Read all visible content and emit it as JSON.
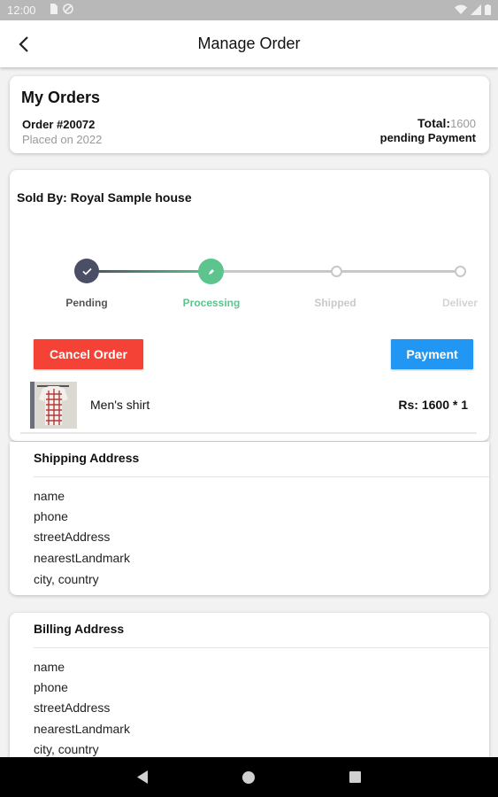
{
  "status_bar": {
    "time": "12:00"
  },
  "app_bar": {
    "title": "Manage Order"
  },
  "order_summary": {
    "heading": "My Orders",
    "order_number": "Order #20072",
    "placed": "Placed on 2022",
    "total_label": "Total:",
    "total_value": "1600",
    "payment_status": "pending Payment"
  },
  "order_detail": {
    "sold_by": "Sold By: Royal Sample house",
    "progress": {
      "current_step_index": 1,
      "steps": [
        {
          "label": "Pending",
          "state": "completed"
        },
        {
          "label": "Processing",
          "state": "current"
        },
        {
          "label": "Shipped",
          "state": "upcoming"
        },
        {
          "label": "Deliver",
          "state": "upcoming"
        }
      ]
    },
    "cancel_label": "Cancel Order",
    "payment_label": "Payment",
    "item": {
      "name": "Men's shirt",
      "price": "Rs: 1600 * 1"
    }
  },
  "shipping_address": {
    "heading": "Shipping Address",
    "lines": [
      "name",
      "phone",
      "streetAddress",
      "nearestLandmark",
      "city, country"
    ]
  },
  "billing_address": {
    "heading": "Billing Address",
    "lines": [
      "name",
      "phone",
      "streetAddress",
      "nearestLandmark",
      "city, country"
    ]
  },
  "colors": {
    "cancel": "#f44336",
    "payment": "#2196f3",
    "step_done": "#4a4f66",
    "step_current": "#5cc48c",
    "step_upcoming": "#c8c8c8"
  },
  "icons": {
    "back": "arrow-back-icon",
    "step_done": "check-icon",
    "nav": [
      "nav-back-icon",
      "nav-home-icon",
      "nav-recents-icon"
    ]
  }
}
